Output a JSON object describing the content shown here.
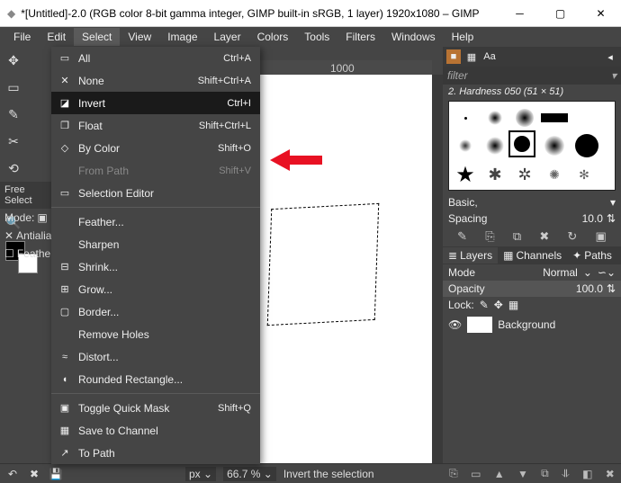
{
  "window": {
    "title": "*[Untitled]-2.0 (RGB color 8-bit gamma integer, GIMP built-in sRGB, 1 layer) 1920x1080 – GIMP"
  },
  "menubar": [
    "File",
    "Edit",
    "Select",
    "View",
    "Image",
    "Layer",
    "Colors",
    "Tools",
    "Filters",
    "Windows",
    "Help"
  ],
  "select_menu": [
    {
      "label": "All",
      "accel": "Ctrl+A",
      "icon": "▭"
    },
    {
      "label": "None",
      "accel": "Shift+Ctrl+A",
      "icon": "✕"
    },
    {
      "label": "Invert",
      "accel": "Ctrl+I",
      "icon": "◪",
      "hl": true
    },
    {
      "label": "Float",
      "accel": "Shift+Ctrl+L",
      "icon": "❐"
    },
    {
      "label": "By Color",
      "accel": "Shift+O",
      "icon": "◇"
    },
    {
      "label": "From Path",
      "accel": "Shift+V",
      "icon": "",
      "dis": true
    },
    {
      "label": "Selection Editor",
      "accel": "",
      "icon": "▭"
    },
    {
      "sep": true
    },
    {
      "label": "Feather...",
      "accel": "",
      "icon": ""
    },
    {
      "label": "Sharpen",
      "accel": "",
      "icon": ""
    },
    {
      "label": "Shrink...",
      "accel": "",
      "icon": "⊟"
    },
    {
      "label": "Grow...",
      "accel": "",
      "icon": "⊞"
    },
    {
      "label": "Border...",
      "accel": "",
      "icon": "▢"
    },
    {
      "label": "Remove Holes",
      "accel": "",
      "icon": ""
    },
    {
      "label": "Distort...",
      "accel": "",
      "icon": "≈"
    },
    {
      "label": "Rounded Rectangle...",
      "accel": "",
      "icon": "◖"
    },
    {
      "sep": true
    },
    {
      "label": "Toggle Quick Mask",
      "accel": "Shift+Q",
      "icon": "▣"
    },
    {
      "label": "Save to Channel",
      "accel": "",
      "icon": "▦"
    },
    {
      "label": "To Path",
      "accel": "",
      "icon": "↗"
    }
  ],
  "tool_options": {
    "title": "Free Select",
    "mode": "Mode:",
    "antialias": "Antialias",
    "feather": "Feather"
  },
  "ruler": {
    "mark": "1000"
  },
  "brushes": {
    "filter": "filter",
    "label": "2. Hardness 050 (51 × 51)",
    "preset": "Basic,",
    "spacing_label": "Spacing",
    "spacing_value": "10.0"
  },
  "layers": {
    "tabs": [
      "Layers",
      "Channels",
      "Paths"
    ],
    "mode_label": "Mode",
    "mode_value": "Normal",
    "opacity_label": "Opacity",
    "opacity_value": "100.0",
    "lock_label": "Lock:",
    "layer_name": "Background"
  },
  "status": {
    "unit": "px",
    "zoom": "66.7 %",
    "hint": "Invert the selection"
  }
}
